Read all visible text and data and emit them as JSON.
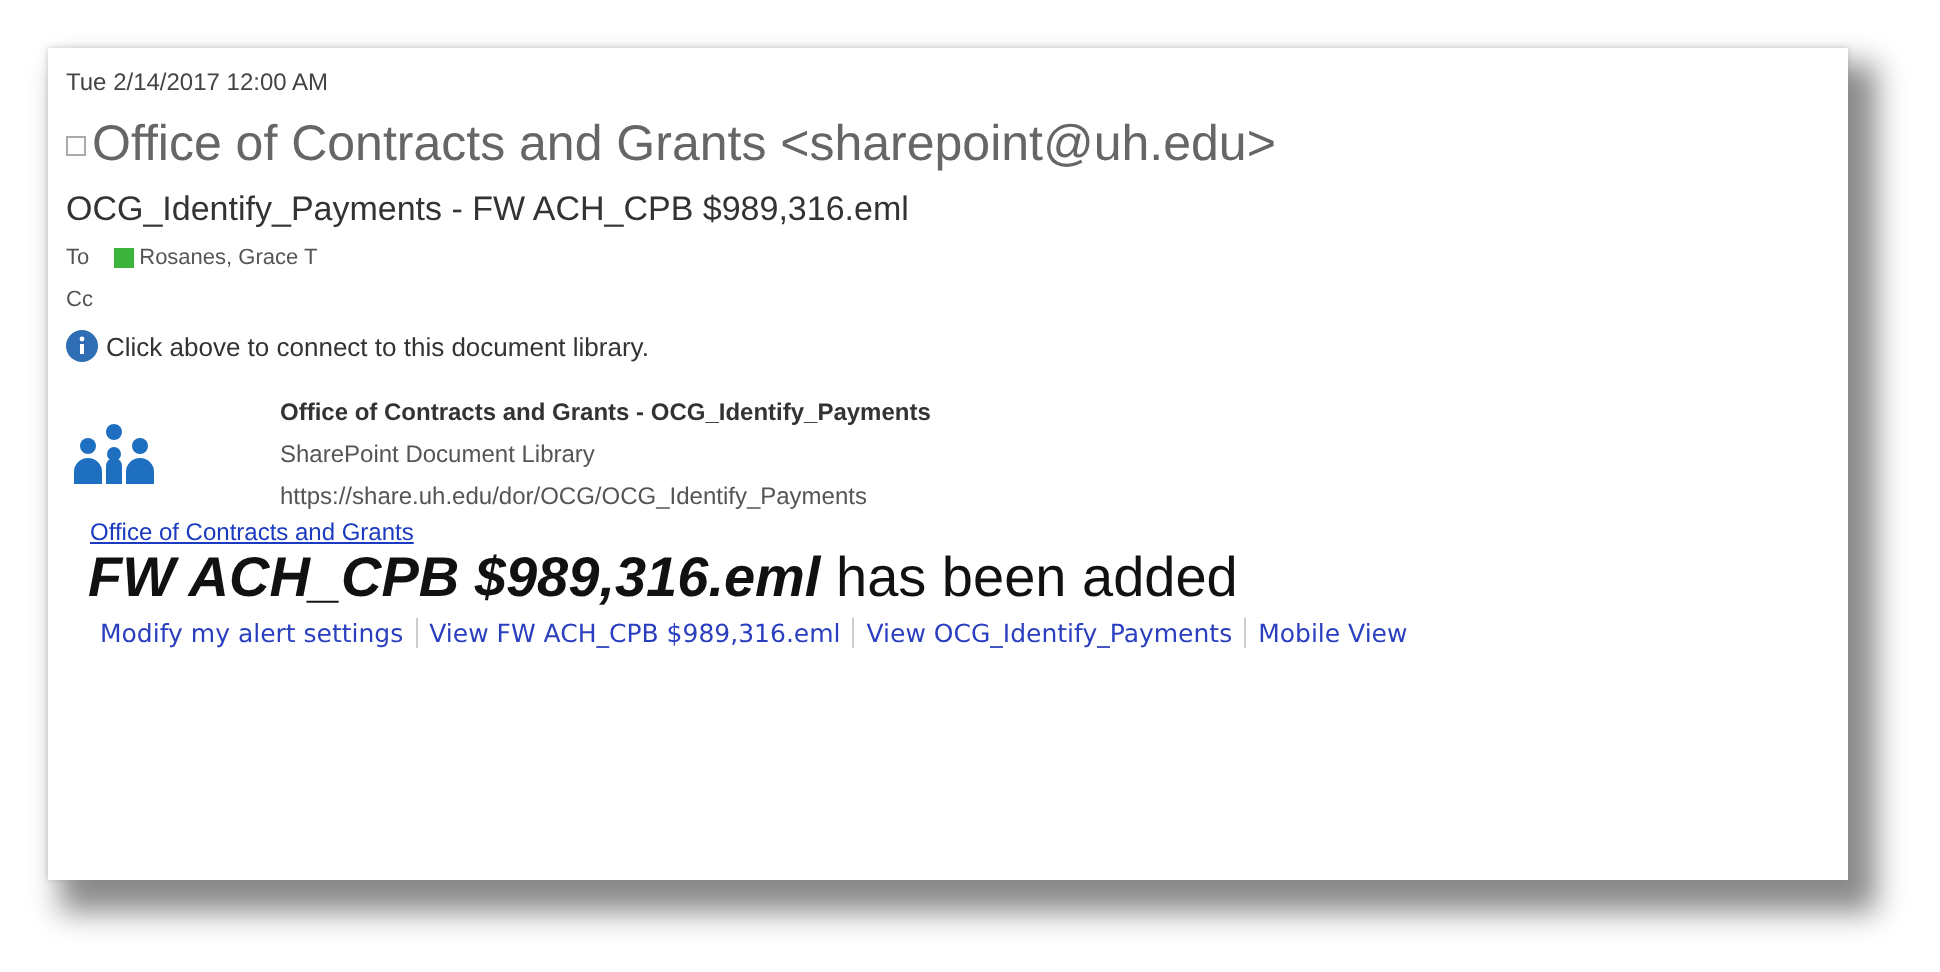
{
  "header": {
    "date": "Tue 2/14/2017 12:00 AM",
    "sender": "Office of Contracts and Grants <sharepoint@uh.edu>",
    "subject": "OCG_Identify_Payments - FW ACH_CPB $989,316.eml",
    "to_label": "To",
    "recipients": [
      {
        "name": "Rosanes, Grace T",
        "color": "#3cb43c"
      }
    ],
    "cc_label": "Cc"
  },
  "info_bar": {
    "text": "Click above to connect to this document library."
  },
  "library": {
    "title": "Office of Contracts and Grants - OCG_Identify_Payments",
    "type": "SharePoint Document Library",
    "url": "https://share.uh.edu/dor/OCG/OCG_Identify_Payments"
  },
  "alert": {
    "site_link": "Office of Contracts and Grants",
    "headline": "**FW ACH_CPB $989,316.eml** has been added",
    "links": [
      "Modify my alert settings",
      "View FW ACH_CPB $989,316.eml",
      "View OCG_Identify_Payments",
      "Mobile View"
    ]
  }
}
